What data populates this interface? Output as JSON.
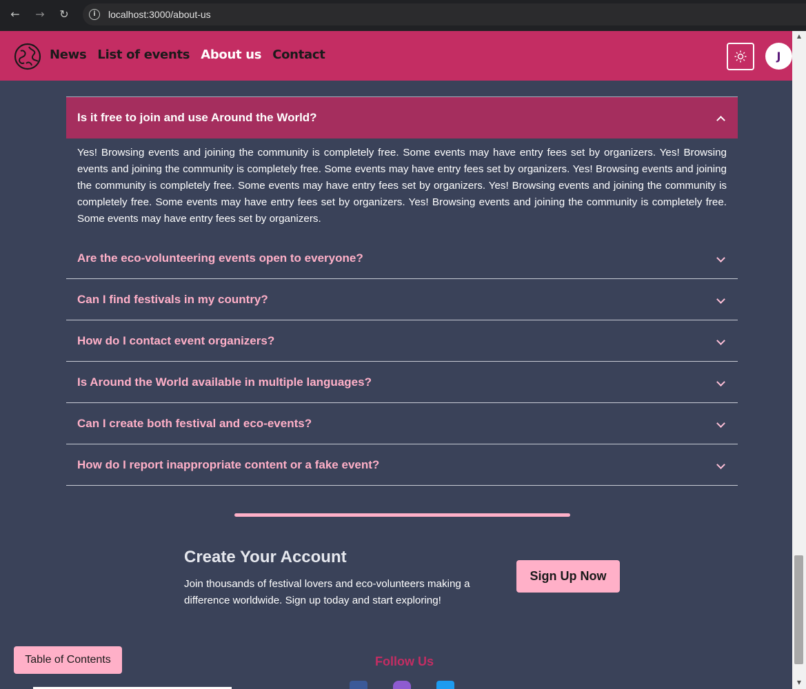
{
  "browser": {
    "url": "localhost:3000/about-us"
  },
  "nav": {
    "links": [
      "News",
      "List of events",
      "About us",
      "Contact"
    ],
    "avatar_initial": "J"
  },
  "faq": {
    "open_question": "Is it free to join and use Around the World?",
    "open_answer": "Yes! Browsing events and joining the community is completely free. Some events may have entry fees set by organizers. Yes! Browsing events and joining the community is completely free. Some events may have entry fees set by organizers. Yes! Browsing events and joining the community is completely free. Some events may have entry fees set by organizers. Yes! Browsing events and joining the community is completely free. Some events may have entry fees set by organizers. Yes! Browsing events and joining the community is completely free. Some events may have entry fees set by organizers.",
    "items": [
      "Are the eco-volunteering events open to everyone?",
      "Can I find festivals in my country?",
      "How do I contact event organizers?",
      "Is Around the World available in multiple languages?",
      "Can I create both festival and eco-events?",
      "How do I report inappropriate content or a fake event?"
    ]
  },
  "cta": {
    "title": "Create Your Account",
    "text": "Join thousands of festival lovers and eco-volunteers making a difference worldwide. Sign up today and start exploring!",
    "button": "Sign Up Now"
  },
  "toc_button": "Table of Contents",
  "footer": {
    "follow_label": "Follow Us"
  },
  "colors": {
    "nav_bg": "#c42d63",
    "page_bg": "#3a4259",
    "accent_pink": "#ffb0c8",
    "open_item_bg": "#a52e5e"
  },
  "icons": [
    "back-arrow-icon",
    "forward-arrow-icon",
    "reload-icon",
    "site-info-icon",
    "globe-logo-icon",
    "sun-icon",
    "chevron-up-icon",
    "chevron-down-icon",
    "facebook-icon",
    "instagram-icon",
    "twitter-icon"
  ]
}
